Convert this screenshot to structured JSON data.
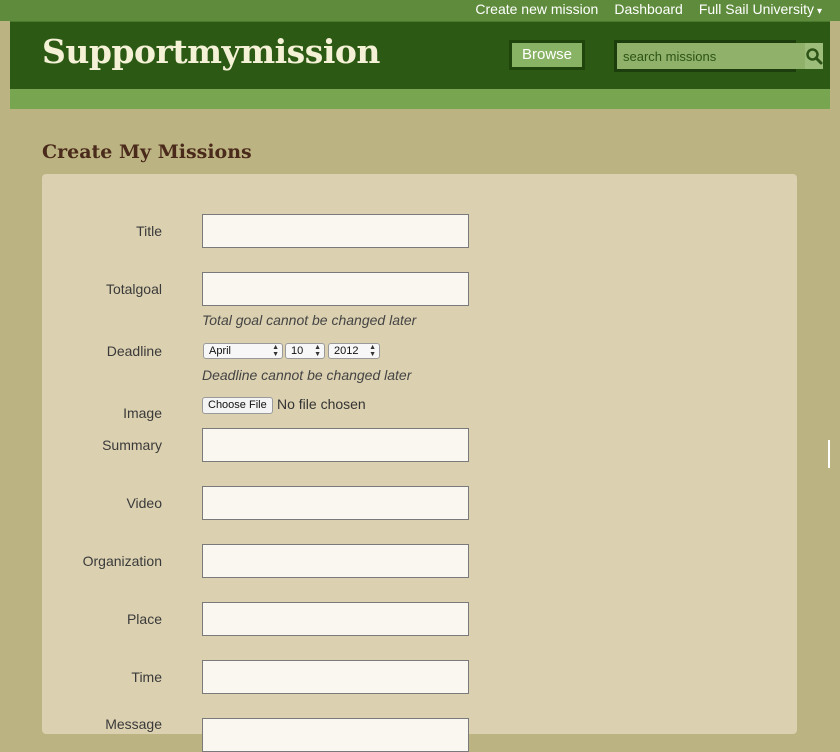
{
  "nav": {
    "create_label": "Create new mission",
    "dashboard_label": "Dashboard",
    "university_label": "Full Sail University",
    "caret": "▾"
  },
  "header": {
    "logo": "Supportmymission",
    "browse_label": "Browse",
    "search_placeholder": "search missions"
  },
  "page": {
    "title": "Create My Missions"
  },
  "form": {
    "title_label": "Title",
    "totalgoal_label": "Totalgoal",
    "totalgoal_hint": "Total goal cannot be changed later",
    "deadline_label": "Deadline",
    "deadline_month": "April",
    "deadline_day": "10",
    "deadline_year": "2012",
    "deadline_hint": "Deadline cannot be changed later",
    "image_label": "Image",
    "choose_file_label": "Choose File",
    "no_file_text": "No file chosen",
    "summary_label": "Summary",
    "video_label": "Video",
    "organization_label": "Organization",
    "place_label": "Place",
    "time_label": "Time",
    "message_label": "Message"
  },
  "colors": {
    "top_bar": "#5f8c3c",
    "header": "#2c5a14",
    "sub_bar": "#78a550",
    "page_bg": "#bcb382",
    "panel": "#dbd0b0",
    "title_text": "#4a2a1a"
  },
  "icons": {
    "search": "magnifier-icon",
    "select": "updown-arrows-icon"
  }
}
